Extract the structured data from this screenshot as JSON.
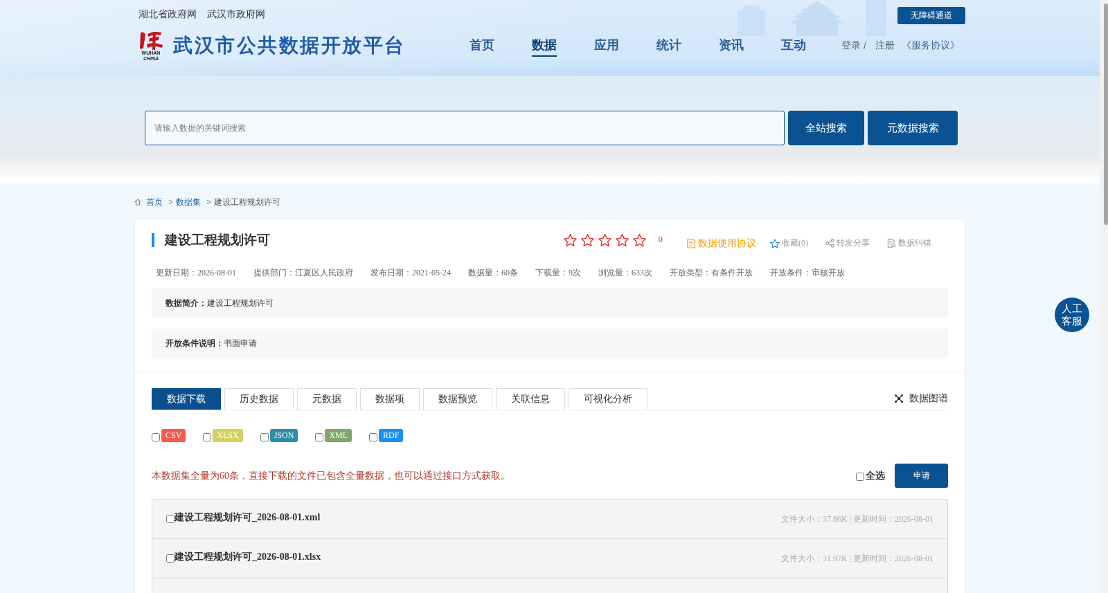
{
  "header": {
    "top_links": [
      "湖北省政府网",
      "武汉市政府网"
    ],
    "accessibility_button": "无障碍通道",
    "logo": {
      "caption_top": "WUHAN",
      "caption_bottom": "CHINA",
      "title": "武汉市公共数据开放平台"
    },
    "nav": [
      {
        "label": "首页",
        "selected": false
      },
      {
        "label": "数据",
        "selected": true
      },
      {
        "label": "应用",
        "selected": false
      },
      {
        "label": "统计",
        "selected": false
      },
      {
        "label": "资讯",
        "selected": false
      },
      {
        "label": "互动",
        "selected": false
      }
    ],
    "account": {
      "login": "登录",
      "separator": "/",
      "register": "注册",
      "agreement": "《服务协议》"
    }
  },
  "search": {
    "placeholder": "请输入数据的关键词搜索",
    "buttons": [
      "全站搜索",
      "元数据搜索"
    ]
  },
  "breadcrumb": [
    {
      "kind": "link",
      "label": "首页"
    },
    {
      "kind": "separator",
      "label": ">"
    },
    {
      "kind": "link",
      "label": "数据集"
    },
    {
      "kind": "separator",
      "label": ">"
    },
    {
      "kind": "current",
      "label": "建设工程规划许可"
    }
  ],
  "dataset": {
    "title": "建设工程规划许可",
    "rating": {
      "stars": 0,
      "count": "0"
    },
    "actions": [
      {
        "kind": "agreement",
        "label": "数据使用协议"
      },
      {
        "kind": "favorite",
        "label": "收藏(0)"
      },
      {
        "kind": "share",
        "label": "转发分享"
      },
      {
        "kind": "report",
        "label": "数据纠错"
      }
    ],
    "meta": [
      "更新日期：2026-08-01",
      "提供部门：江夏区人民政府",
      "发布日期：2021-05-24",
      "数据量：60条",
      "下载量：9次",
      "浏览量：633次",
      "开放类型：有条件开放",
      "开放条件：审核开放"
    ],
    "intro": "**数据简介：**建设工程规划许可",
    "condition_note": "**开放条件说明：**书面申请"
  },
  "tabs": [
    {
      "label": "数据下载",
      "selected": true
    },
    {
      "label": "历史数据",
      "selected": false
    },
    {
      "label": "元数据",
      "selected": false
    },
    {
      "label": "数据项",
      "selected": false
    },
    {
      "label": "数据预览",
      "selected": false
    },
    {
      "label": "关联信息",
      "selected": false
    },
    {
      "label": "可视化分析",
      "selected": false
    }
  ],
  "graph_link": "数据图谱",
  "formats": [
    {
      "label": "CSV",
      "color": "#f45b4c",
      "checked": false
    },
    {
      "label": "XLSX",
      "color": "#d6d063",
      "checked": false
    },
    {
      "label": "JSON",
      "color": "#2b8fa6",
      "checked": false
    },
    {
      "label": "XML",
      "color": "#83a56d",
      "checked": false
    },
    {
      "label": "RDF",
      "color": "#1c8ef2",
      "checked": false
    }
  ],
  "notice": "本数据集全量为60条，直接下载的文件已包含全量数据，也可以通过接口方式获取。",
  "select_all": {
    "label": "全选",
    "checked": false
  },
  "apply_button": "申请",
  "files": [
    {
      "name": "建设工程规划许可_2026-08-01.xml",
      "info": "文件大小：37.86K | 更新时间：2026-08-01",
      "checked": false
    },
    {
      "name": "建设工程规划许可_2026-08-01.xlsx",
      "info": "文件大小：11.97K | 更新时间：2026-08-01",
      "checked": false
    }
  ],
  "service_button": "人工客服"
}
